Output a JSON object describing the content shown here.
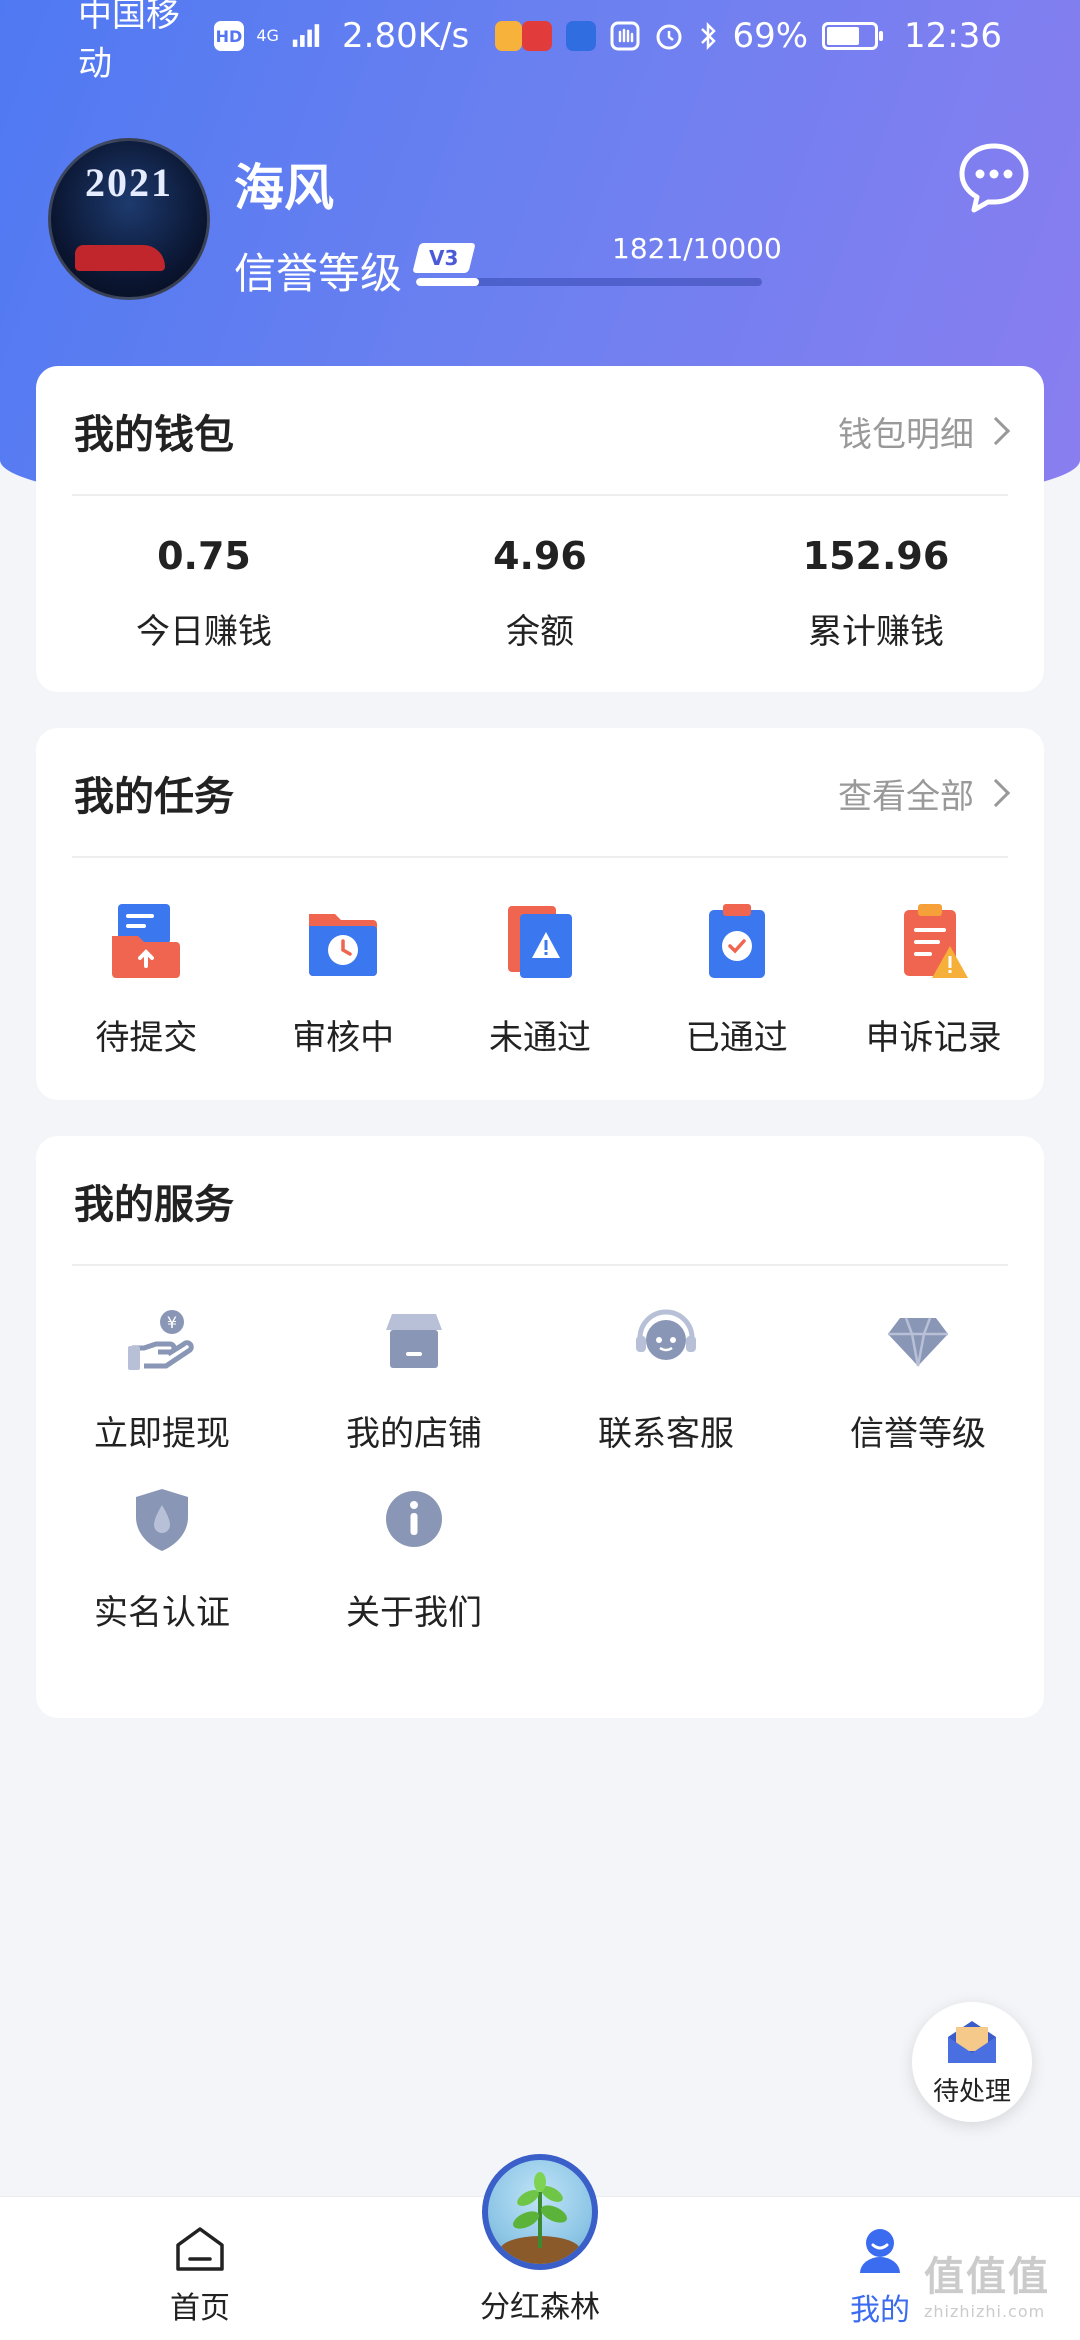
{
  "status_bar": {
    "carrier": "中国移动",
    "hd": "HD",
    "net": "4G",
    "speed": "2.80K/s",
    "battery": "69%",
    "battery_level": 0.69,
    "time": "12:36"
  },
  "profile": {
    "name": "海风",
    "credit_label": "信誉等级",
    "level": "V3",
    "progress_text": "1821/10000",
    "progress_fraction": 0.1821
  },
  "wallet": {
    "title": "我的钱包",
    "link": "钱包明细",
    "stats": [
      {
        "value": "0.75",
        "label": "今日赚钱"
      },
      {
        "value": "4.96",
        "label": "余额"
      },
      {
        "value": "152.96",
        "label": "累计赚钱"
      }
    ]
  },
  "tasks": {
    "title": "我的任务",
    "link": "查看全部",
    "items": [
      {
        "label": "待提交",
        "icon": "upload-folder-icon"
      },
      {
        "label": "审核中",
        "icon": "clock-folder-icon"
      },
      {
        "label": "未通过",
        "icon": "warning-doc-icon"
      },
      {
        "label": "已通过",
        "icon": "check-clipboard-icon"
      },
      {
        "label": "申诉记录",
        "icon": "appeal-record-icon"
      }
    ]
  },
  "services": {
    "title": "我的服务",
    "items": [
      {
        "label": "立即提现",
        "icon": "withdraw-icon"
      },
      {
        "label": "我的店铺",
        "icon": "store-icon"
      },
      {
        "label": "联系客服",
        "icon": "headset-icon"
      },
      {
        "label": "信誉等级",
        "icon": "diamond-icon"
      },
      {
        "label": "实名认证",
        "icon": "shield-icon"
      },
      {
        "label": "关于我们",
        "icon": "info-icon"
      }
    ]
  },
  "pending": {
    "label": "待处理"
  },
  "nav": {
    "home": "首页",
    "forest": "分红森林",
    "mine": "我的"
  },
  "colors": {
    "accent": "#3b6cf0",
    "header_start": "#4f79f2",
    "header_end": "#8a7ef0"
  }
}
